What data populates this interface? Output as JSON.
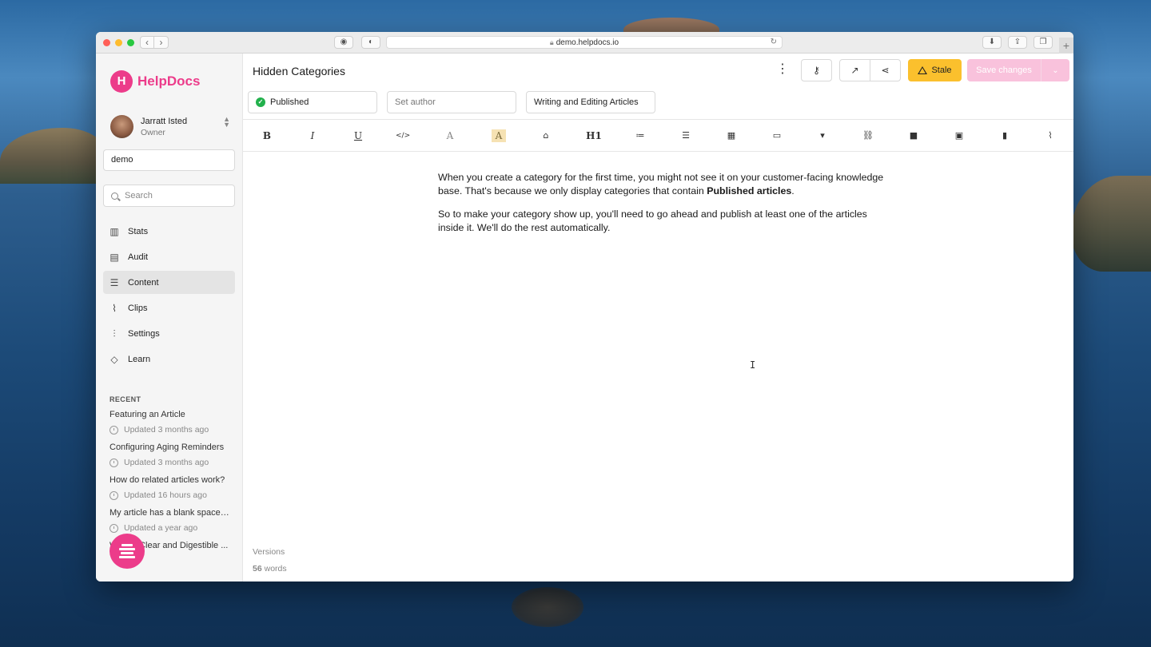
{
  "browser": {
    "url": "demo.helpdocs.io"
  },
  "sidebar": {
    "brand": "HelpDocs",
    "user": {
      "name": "Jarratt Isted",
      "role": "Owner"
    },
    "kb_select": "demo",
    "search_placeholder": "Search",
    "nav": [
      {
        "label": "Stats",
        "icon": "bar-chart-icon"
      },
      {
        "label": "Audit",
        "icon": "clipboard-icon"
      },
      {
        "label": "Content",
        "icon": "stack-icon",
        "active": true
      },
      {
        "label": "Clips",
        "icon": "paperclip-icon"
      },
      {
        "label": "Settings",
        "icon": "sliders-icon"
      },
      {
        "label": "Learn",
        "icon": "graduation-cap-icon"
      }
    ],
    "recent_heading": "RECENT",
    "recent": [
      {
        "title": "Featuring an Article",
        "meta": "Updated 3 months ago"
      },
      {
        "title": "Configuring Aging Reminders",
        "meta": "Updated 3 months ago"
      },
      {
        "title": "How do related articles work?",
        "meta": "Updated 16 hours ago"
      },
      {
        "title": "My article has a blank space ...",
        "meta": "Updated a year ago"
      },
      {
        "title": "Writing Clear and Digestible ...",
        "meta": ""
      }
    ]
  },
  "article": {
    "title": "Hidden Categories",
    "status": "Published",
    "author_placeholder": "Set author",
    "category": "Writing and Editing Articles",
    "stale_label": "Stale",
    "save_label": "Save changes",
    "body": {
      "p1_a": "When you create a category for the first time, you might not see it on your customer-facing knowledge base. That's because we only display categories that contain ",
      "p1_bold": "Published articles",
      "p1_b": ".",
      "p2": "So to make your category show up, you'll need to go ahead and publish at least one of the articles inside it. We'll do the rest automatically."
    },
    "versions_label": "Versions",
    "word_count": "56",
    "word_count_suffix": " words"
  },
  "colors": {
    "brand": "#ec3c8a",
    "stale": "#fbc02d",
    "published": "#22b14c"
  }
}
